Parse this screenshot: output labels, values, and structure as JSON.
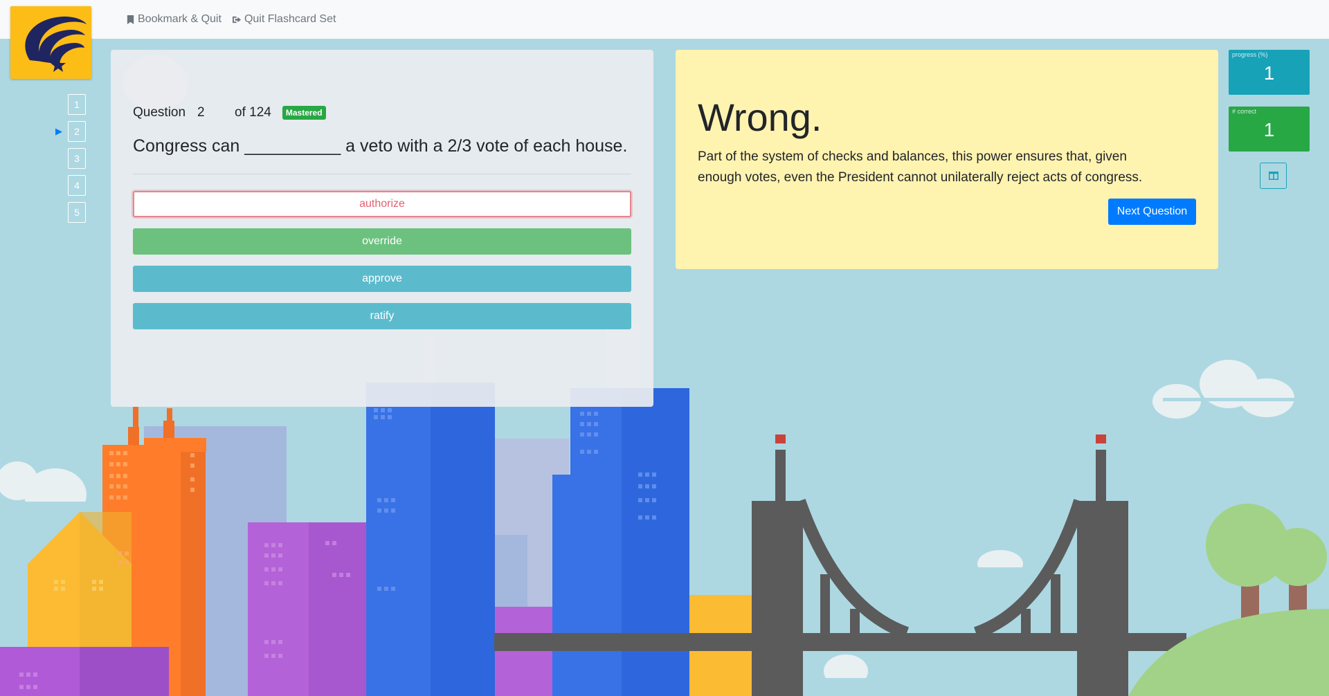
{
  "topnav": {
    "bookmark_label": "Bookmark & Quit",
    "quit_label": "Quit Flashcard Set"
  },
  "question_nav": {
    "items": [
      "1",
      "2",
      "3",
      "4",
      "5"
    ],
    "current": 2
  },
  "question": {
    "label": "Question",
    "number": "2",
    "total_text": "of 124",
    "badge": "Mastered",
    "text": "Congress can __________ a veto with a 2/3 vote of each house.",
    "answers": [
      {
        "label": "authorize",
        "state": "wrong"
      },
      {
        "label": "override",
        "state": "correct"
      },
      {
        "label": "approve",
        "state": "other"
      },
      {
        "label": "ratify",
        "state": "other"
      }
    ]
  },
  "feedback": {
    "heading": "Wrong.",
    "explanation": "Part of the system of checks and balances, this power ensures that, given enough votes, even the President cannot unilaterally reject acts of congress.",
    "next_label": "Next Question"
  },
  "stats": {
    "progress_label": "progress (%)",
    "progress_value": "1",
    "correct_label": "# correct",
    "correct_value": "1"
  },
  "icons": {
    "bookmark": "bookmark-icon",
    "quit": "sign-out-icon",
    "logo": "logo-icon",
    "layout": "columns-icon",
    "arrow": "play-arrow-icon"
  },
  "colors": {
    "logo_bg": "#fdbd17",
    "primary": "#007bff",
    "correct": "#6cc17e",
    "wrong_border": "#e4868f",
    "neutral_answer": "#5bbbcd",
    "feedback_bg": "#fff3b0",
    "progress_stat": "#17a2b8",
    "correct_stat": "#28a745"
  }
}
